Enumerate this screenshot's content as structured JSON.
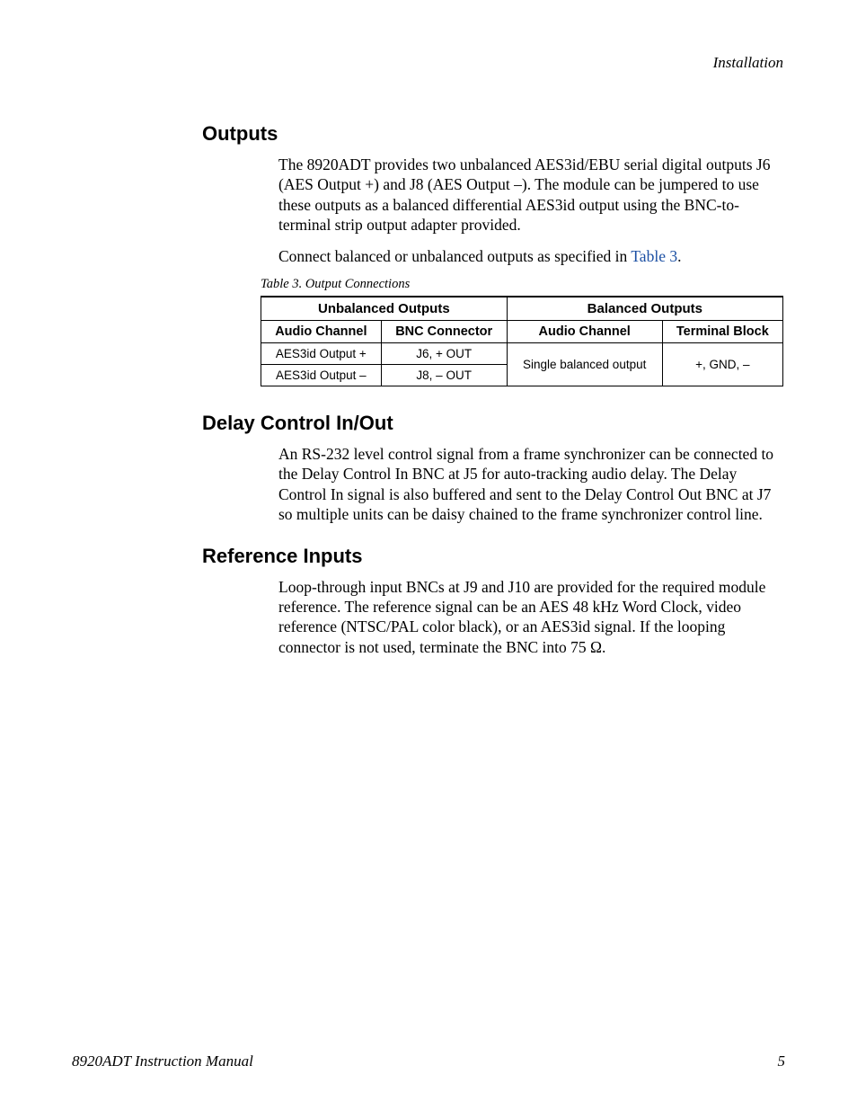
{
  "running_head": "Installation",
  "sections": {
    "outputs": {
      "heading": "Outputs",
      "p1": "The 8920ADT provides two unbalanced AES3id/EBU serial digital outputs J6 (AES Output +) and J8 (AES Output –). The module can be jumpered to use these outputs as a balanced differential AES3id output using the BNC-to-terminal strip output adapter provided.",
      "p2_pre": "Connect balanced or unbalanced outputs as specified in ",
      "p2_link": "Table 3",
      "p2_post": "."
    },
    "table": {
      "caption": "Table 3.  Output Connections",
      "group_headers": [
        "Unbalanced Outputs",
        "Balanced Outputs"
      ],
      "sub_headers": [
        "Audio Channel",
        "BNC Connector",
        "Audio Channel",
        "Terminal Block"
      ],
      "rows": [
        {
          "c0": "AES3id Output +",
          "c1": "J6, + OUT"
        },
        {
          "c0": "AES3id Output –",
          "c1": "J8, – OUT"
        }
      ],
      "merged": {
        "c2": "Single balanced output",
        "c3": "+, GND, –"
      }
    },
    "delay": {
      "heading": "Delay Control In/Out",
      "p1": "An RS-232 level control signal from a frame synchronizer can be connected to the Delay Control In BNC at J5 for auto-tracking audio delay. The Delay Control In signal is also buffered and sent to the Delay Control Out BNC at J7 so multiple units can be daisy chained to the frame synchronizer control line."
    },
    "reference": {
      "heading": "Reference Inputs",
      "p1": "Loop-through input BNCs at J9 and J10 are provided for the required module reference. The reference signal can be an AES 48 kHz Word Clock, video reference (NTSC/PAL color black), or an AES3id signal. If the looping connector is not used, terminate the BNC into 75 Ω."
    }
  },
  "footer": {
    "left": "8920ADT Instruction Manual",
    "right": "5"
  }
}
